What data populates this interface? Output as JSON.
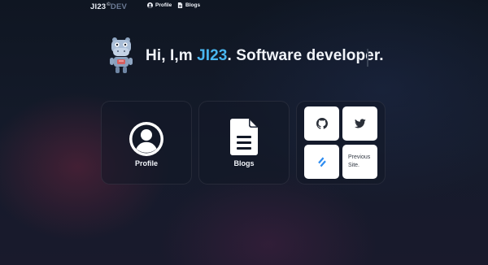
{
  "nav": {
    "logo_main": "JI23",
    "logo_sup": "©",
    "logo_dev": "DEV",
    "links": [
      {
        "label": "Profile",
        "icon": "user-circle-icon"
      },
      {
        "label": "Blogs",
        "icon": "document-icon"
      }
    ]
  },
  "hero": {
    "greeting": "Hi, I,m ",
    "name": "JI23",
    "tagline": ". Software developer.",
    "mascot": "robot-hippo-icon"
  },
  "cards": {
    "profile": {
      "label": "Profile",
      "icon": "user-circle-icon"
    },
    "blogs": {
      "label": "Blogs",
      "icon": "document-icon"
    }
  },
  "links": {
    "github": {
      "icon": "github-icon"
    },
    "twitter": {
      "icon": "twitter-icon"
    },
    "blog": {
      "icon": "blog-logo-icon"
    },
    "previous_site": {
      "line1": "Previous",
      "line2": "Site."
    }
  },
  "colors": {
    "accent": "#49b6ef",
    "background": "#121827",
    "tile": "#ffffff"
  }
}
